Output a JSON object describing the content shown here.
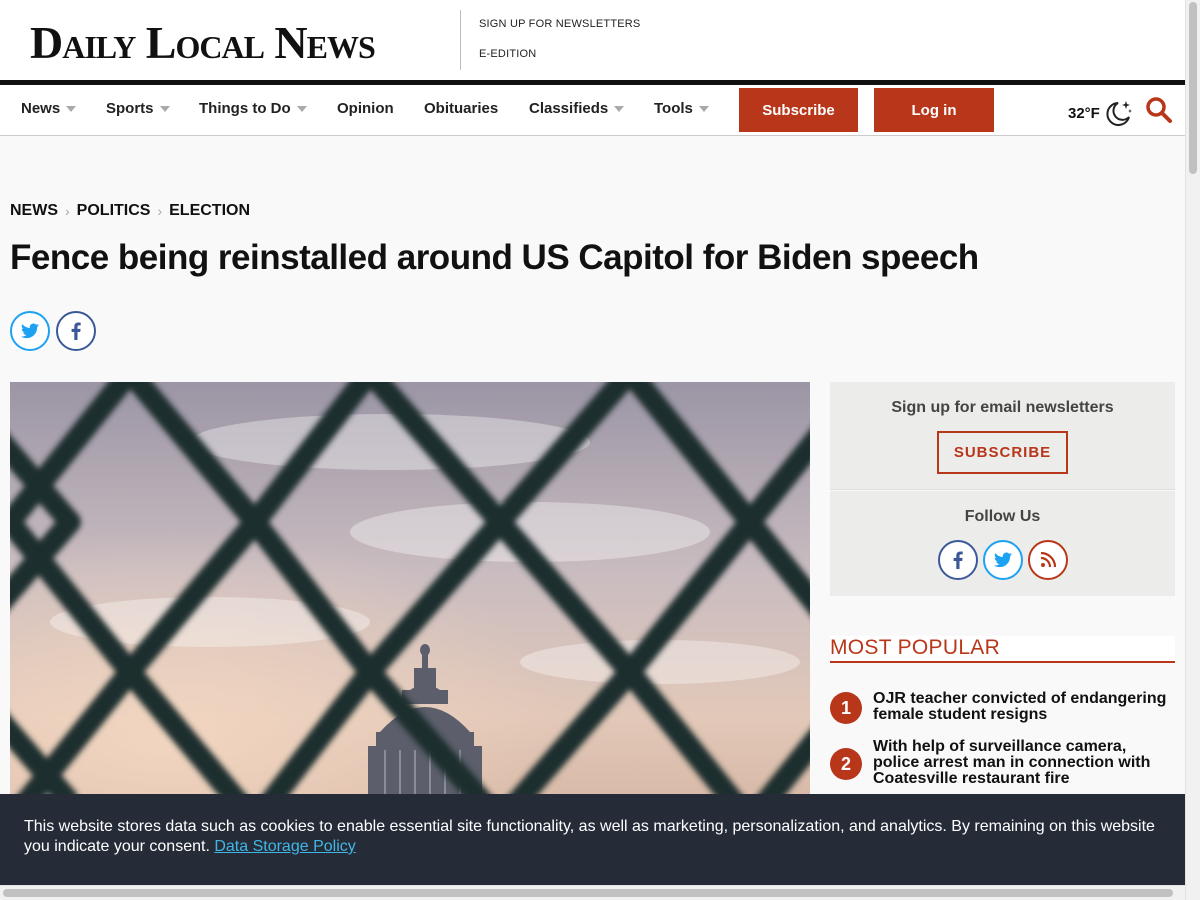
{
  "header": {
    "logo": "Daily Local News",
    "util_links": [
      "SIGN UP FOR NEWSLETTERS",
      "E-EDITION"
    ]
  },
  "nav": {
    "items": [
      {
        "label": "News",
        "dropdown": true
      },
      {
        "label": "Sports",
        "dropdown": true
      },
      {
        "label": "Things to Do",
        "dropdown": true
      },
      {
        "label": "Opinion",
        "dropdown": false
      },
      {
        "label": "Obituaries",
        "dropdown": false
      },
      {
        "label": "Classifieds",
        "dropdown": true
      },
      {
        "label": "Tools",
        "dropdown": true
      }
    ],
    "subscribe_label": "Subscribe",
    "login_label": "Log in",
    "weather": "32°F",
    "weather_icon": "moon-stars-icon",
    "search_icon": "search-icon"
  },
  "article": {
    "breadcrumb": [
      "NEWS",
      "POLITICS",
      "ELECTION"
    ],
    "headline": "Fence being reinstalled around US Capitol for Biden speech",
    "share": [
      "twitter-icon",
      "facebook-icon"
    ]
  },
  "sidebar": {
    "newsletter_title": "Sign up for email newsletters",
    "newsletter_button": "SUBSCRIBE",
    "follow_title": "Follow Us",
    "follow_icons": [
      "facebook-icon",
      "twitter-icon",
      "rss-icon"
    ],
    "most_popular_title": "MOST POPULAR",
    "most_popular": [
      {
        "rank": "1",
        "title": "OJR teacher convicted of endangering female student resigns"
      },
      {
        "rank": "2",
        "title": "With help of surveillance camera, police arrest man in connection with Coatesville restaurant fire"
      }
    ]
  },
  "cookie_banner": {
    "text": "This website stores data such as cookies to enable essential site functionality, as well as marketing, personalization, and analytics. By remaining on this website you indicate your consent.",
    "link": "Data Storage Policy"
  },
  "colors": {
    "accent": "#b8361a",
    "banner_bg": "#252c38",
    "twitter": "#1da1f2",
    "facebook": "#3b5998"
  }
}
